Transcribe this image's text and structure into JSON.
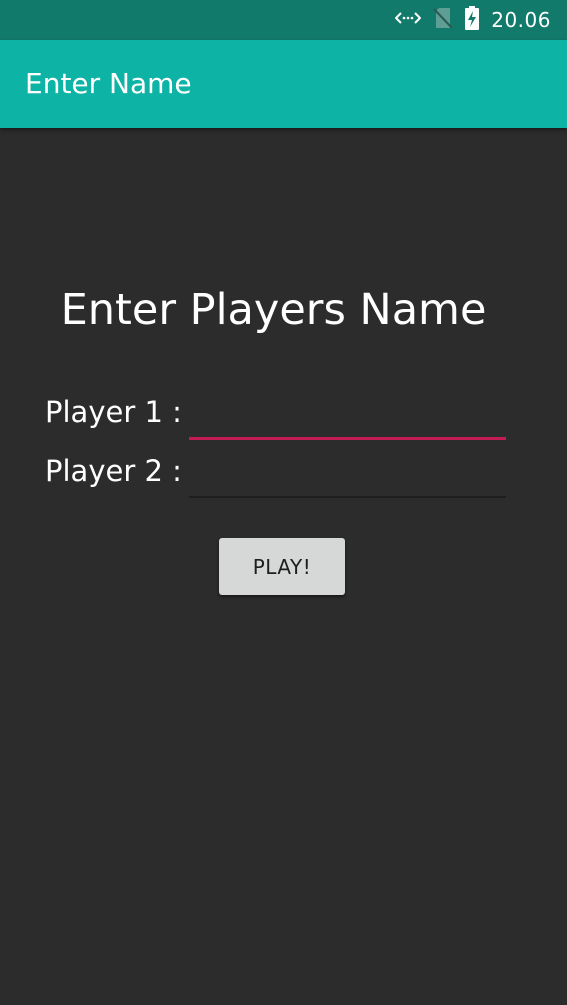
{
  "status_bar": {
    "time": "20.06",
    "icons": [
      "data-transfer-icon",
      "no-sim-icon",
      "battery-charging-icon"
    ],
    "background": "#127a6a"
  },
  "app_bar": {
    "title": "Enter Name",
    "background": "#0db3a4"
  },
  "main": {
    "heading": "Enter Players Name",
    "player1": {
      "label": "Player 1 :",
      "value": "",
      "focused": true
    },
    "player2": {
      "label": "Player 2 :",
      "value": "",
      "focused": false
    },
    "play_button_label": "PLAY!"
  },
  "colors": {
    "background": "#2c2c2c",
    "accent": "#c51b55",
    "button": "#d6d7d7"
  }
}
